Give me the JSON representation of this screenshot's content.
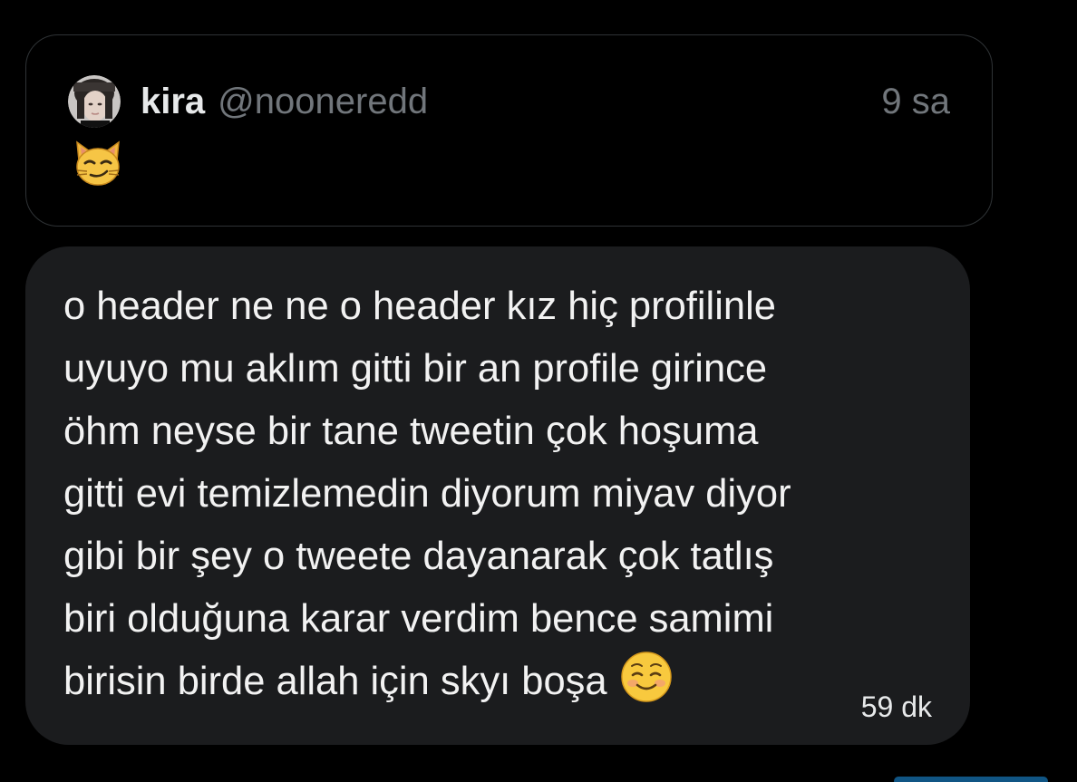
{
  "quote": {
    "author_name": "kira",
    "author_handle": "@nooneredd",
    "time": "9 sa",
    "body_emoji_icon": "smirking-cat-face-icon",
    "avatar_icon": "profile-avatar"
  },
  "message": {
    "text": "o header ne ne o header kız hiç profilinle\nuyuyo mu aklım gitti bir an profile girince\nöhm neyse bir tane tweetin çok hoşuma\ngitti evi temizlemedin diyorum miyav diyor\ngibi bir şey o tweete dayanarak çok tatlış\nbiri olduğuna karar verdim bence samimi\nbirisin birde allah için skyı boşa",
    "trailing_emoji_icon": "smiling-face-icon",
    "time": "59 dk"
  },
  "colors": {
    "background": "#000000",
    "bubble": "#1b1c1e",
    "card_border": "#2f3336",
    "secondary_text": "#71767b",
    "primary_text": "#e7e9ea"
  }
}
